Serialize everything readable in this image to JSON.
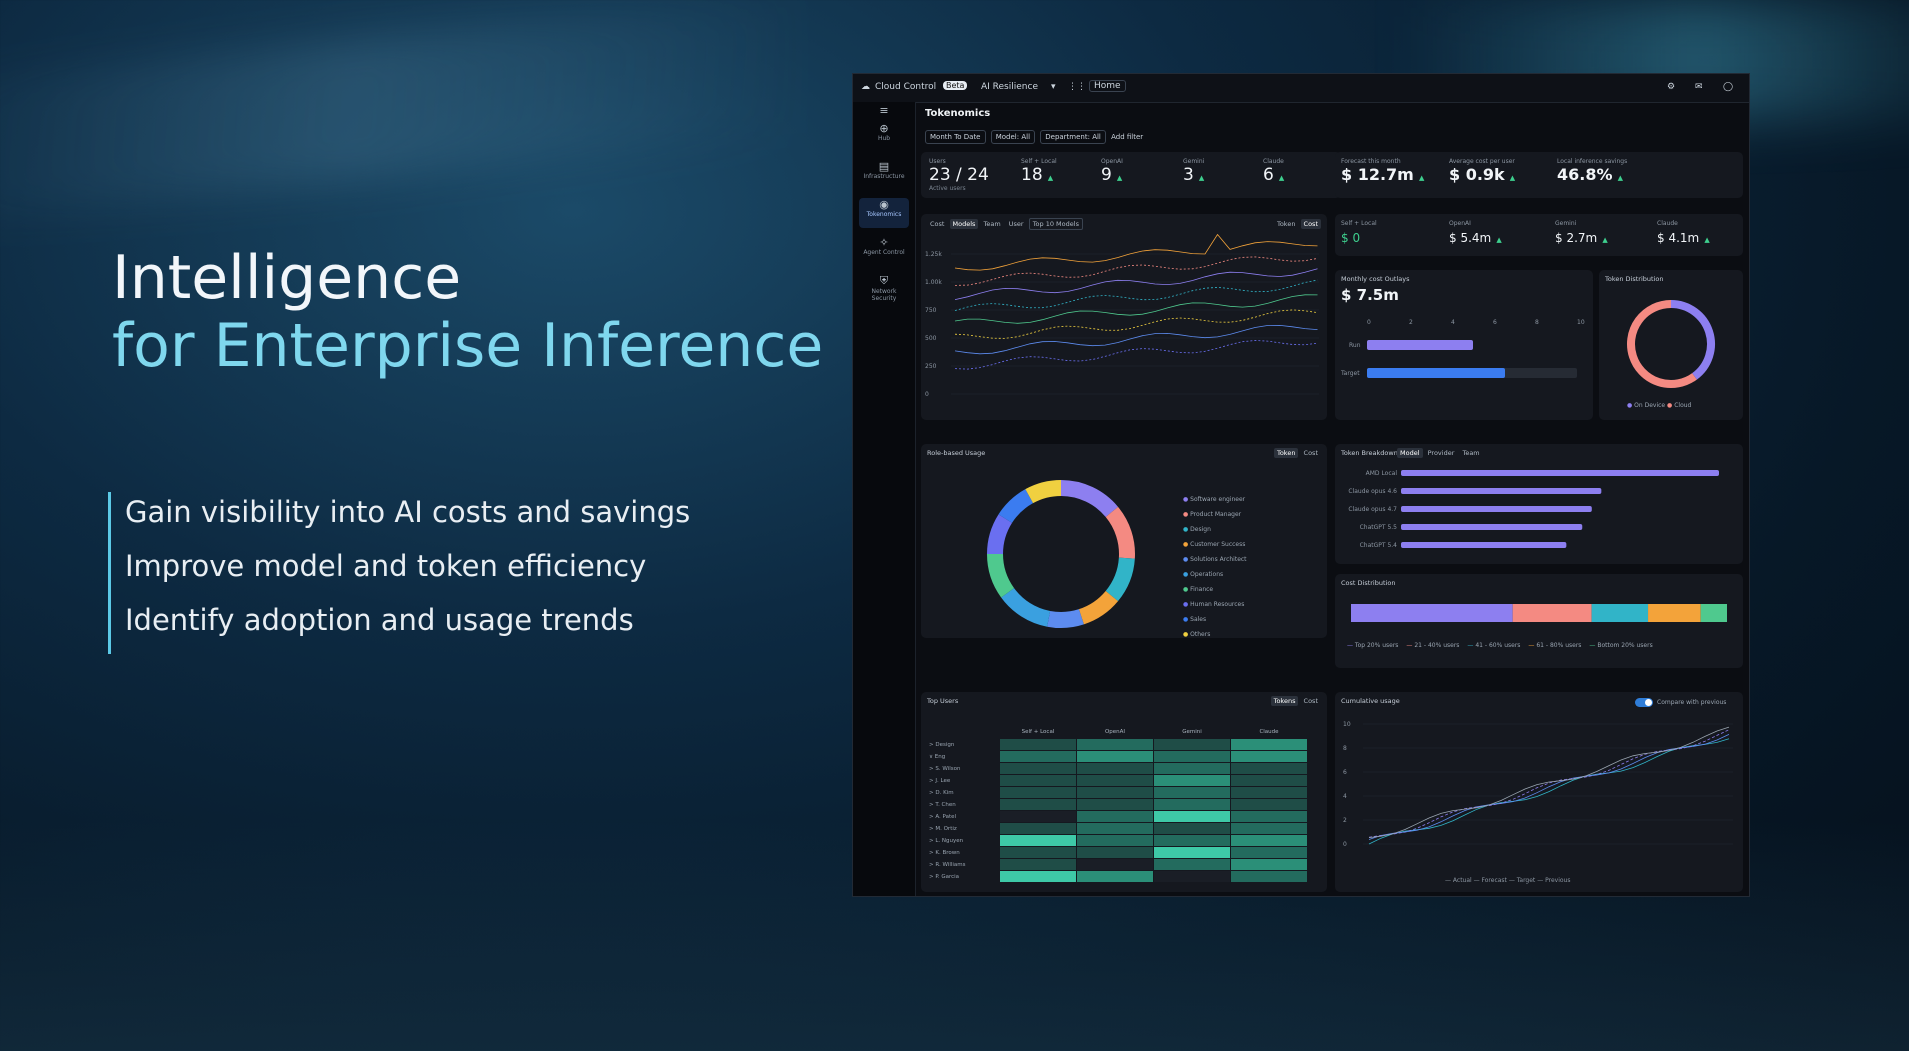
{
  "slide": {
    "headline_line1": "Intelligence",
    "headline_line2": "for Enterprise Inference",
    "bullets": [
      "Gain visibility into AI costs and savings",
      "Improve model and token efficiency",
      "Identify adoption and usage trends"
    ],
    "colors": {
      "accent": "#7fd7ee",
      "bar_accent": "#5cc9e6"
    }
  },
  "app": {
    "name": "Cloud Control",
    "badge": "Beta",
    "workspace": "AI Resilience",
    "home_label": "Home",
    "page_title": "Tokenomics",
    "sidebar": [
      "Hub",
      "Infrastructure",
      "Tokenomics",
      "Agent Control",
      "Network Security"
    ],
    "filters": [
      "Month To Date",
      "Model: All",
      "Department: All",
      "Add filter"
    ]
  },
  "kpis_row1": {
    "users": {
      "label": "Users",
      "value": "23 / 24",
      "sub": "Active users"
    },
    "items": [
      {
        "label": "Self + Local",
        "value": "18"
      },
      {
        "label": "OpenAI",
        "value": "9"
      },
      {
        "label": "Gemini",
        "value": "3"
      },
      {
        "label": "Claude",
        "value": "6"
      }
    ],
    "money": [
      {
        "label": "Forecast this month",
        "value": "$ 12.7m"
      },
      {
        "label": "Average cost per user",
        "value": "$ 0.9k"
      },
      {
        "label": "Local inference savings",
        "value": "46.8%"
      }
    ]
  },
  "kpis_row2": [
    {
      "label": "Self + Local",
      "value": "$ 0"
    },
    {
      "label": "OpenAI",
      "value": "$ 5.4m"
    },
    {
      "label": "Gemini",
      "value": "$ 2.7m"
    },
    {
      "label": "Claude",
      "value": "$ 4.1m"
    }
  ],
  "main_chart": {
    "tabs": [
      "Cost",
      "Models",
      "Team",
      "User"
    ],
    "select": "Top 10 Models",
    "right_tabs": [
      "Token",
      "Cost"
    ],
    "y_ticks": [
      "1.25k",
      "1.00k",
      "750",
      "500",
      "250",
      "0"
    ]
  },
  "budget": {
    "title": "Monthly cost Outlays",
    "value": "$ 7.5m",
    "axis": [
      "0",
      "2",
      "4",
      "6",
      "8",
      "10"
    ],
    "rows": [
      {
        "label": "Run"
      },
      {
        "label": "Target"
      }
    ]
  },
  "token_dist": {
    "title": "Token Distribution",
    "chart_data": {
      "type": "pie",
      "labels": [
        "On Device",
        "Cloud"
      ],
      "values": [
        40,
        60
      ],
      "colors": [
        "#8d7ff0",
        "#f48a82"
      ]
    }
  },
  "role_usage": {
    "title": "Role-based Usage",
    "tabs": [
      "Token",
      "Cost"
    ],
    "chart_data": {
      "type": "pie",
      "labels": [
        "Software engineer",
        "Product Manager",
        "Design",
        "Customer Success",
        "Solutions Architect",
        "Operations",
        "Finance",
        "Human Resources",
        "Sales",
        "Others"
      ],
      "values": [
        14,
        12,
        10,
        9,
        8,
        12,
        10,
        9,
        8,
        8
      ],
      "colors": [
        "#8d7ff0",
        "#f48a82",
        "#31b4c8",
        "#f3a33a",
        "#5d8cf0",
        "#3aa0e0",
        "#4fc98e",
        "#6a6ff0",
        "#3b7cf0",
        "#f0d040"
      ]
    }
  },
  "token_breakdown": {
    "title": "Token Breakdown",
    "tabs": [
      "Model",
      "Provider",
      "Team"
    ],
    "chart_data": {
      "type": "bar",
      "categories": [
        "AMD Local",
        "Claude opus 4.6",
        "Claude opus 4.7",
        "ChatGPT 5.5",
        "ChatGPT 5.4"
      ],
      "values": [
        100,
        63,
        60,
        57,
        52
      ]
    }
  },
  "cost_dist": {
    "title": "Cost Distribution",
    "legend": [
      "Top 20% users",
      "21 - 40% users",
      "41 - 60% users",
      "61 - 80% users",
      "Bottom 20% users"
    ],
    "chart_data": {
      "type": "bar",
      "values": [
        43,
        21,
        15,
        14,
        7
      ],
      "colors": [
        "#8d7ff0",
        "#f48a82",
        "#31b4c8",
        "#f3a33a",
        "#4fc98e"
      ]
    }
  },
  "heatmap": {
    "title": "Top Users",
    "tabs": [
      "Tokens",
      "Cost"
    ],
    "columns": [
      "Self + Local",
      "OpenAI",
      "Gemini",
      "Claude"
    ],
    "rows": [
      {
        "name": "> Design",
        "cells": [
          1,
          2,
          1,
          3
        ]
      },
      {
        "name": "∨ Eng",
        "cells": [
          2,
          3,
          2,
          3
        ]
      },
      {
        "name": "> S. Wilson",
        "cells": [
          1,
          1,
          2,
          1
        ]
      },
      {
        "name": "> J. Lee",
        "cells": [
          1,
          1,
          3,
          1
        ]
      },
      {
        "name": "> D. Kim",
        "cells": [
          1,
          1,
          2,
          1
        ]
      },
      {
        "name": "> T. Chen",
        "cells": [
          1,
          1,
          2,
          1
        ]
      },
      {
        "name": "> A. Patel",
        "cells": [
          0,
          2,
          4,
          2
        ]
      },
      {
        "name": "> M. Ortiz",
        "cells": [
          1,
          2,
          1,
          2
        ]
      },
      {
        "name": "> L. Nguyen",
        "cells": [
          4,
          2,
          2,
          3
        ]
      },
      {
        "name": "> K. Brown",
        "cells": [
          1,
          1,
          4,
          2
        ]
      },
      {
        "name": "> R. Williams",
        "cells": [
          1,
          0,
          2,
          3
        ]
      },
      {
        "name": "> P. Garcia",
        "cells": [
          4,
          3,
          0,
          2
        ]
      }
    ]
  },
  "cumulative": {
    "title": "Cumulative usage",
    "toggle_label": "Compare with previous",
    "y_ticks": [
      "10",
      "8",
      "6",
      "4",
      "2",
      "0"
    ],
    "legend": [
      "Actual",
      "Forecast",
      "Target",
      "Previous"
    ]
  }
}
